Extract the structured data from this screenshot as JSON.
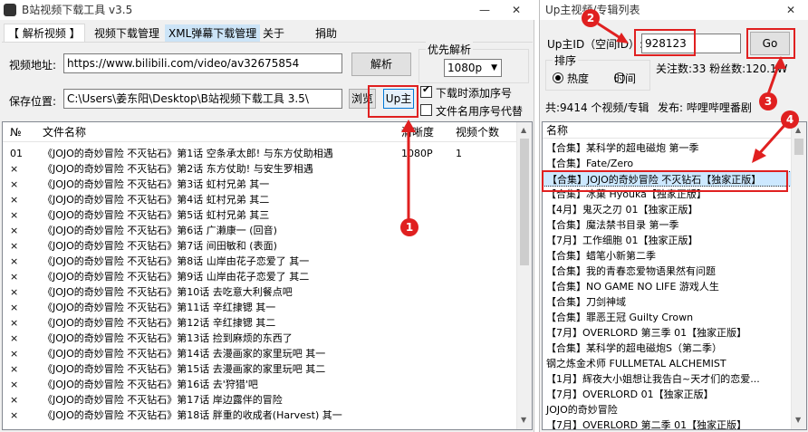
{
  "main_window": {
    "title": "B站视频下载工具 v3.5",
    "controls": {
      "minimize": "—",
      "close": "✕"
    },
    "tabs": [
      "【 解析视频 】",
      "视频下载管理",
      "XML弹幕下载管理",
      "关于",
      "捐助"
    ],
    "video_url_label": "视频地址:",
    "video_url_value": "https://www.bilibili.com/video/av32675854",
    "parse_button": "解析",
    "priority_label": "优先解析",
    "priority_value": "1080p",
    "save_label": "保存位置:",
    "save_value": "C:\\Users\\姜东阳\\Desktop\\B站视频下载工具 3.5\\",
    "browse_button": "浏览",
    "up_button": "Up主",
    "add_seq_label": "下载时添加序号",
    "filename_seq_label": "文件名用序号代替",
    "columns": [
      "№",
      "文件名称",
      "清晰度",
      "视频个数"
    ],
    "rows": [
      {
        "no": "01",
        "name": "《JOJO的奇妙冒险 不灭钻石》第1话 空条承太郎! 与东方仗助相遇",
        "quality": "1080P",
        "count": "1"
      },
      {
        "no": "×",
        "name": "《JOJO的奇妙冒险 不灭钻石》第2话 东方仗助! 与安生罗相遇",
        "quality": "",
        "count": ""
      },
      {
        "no": "×",
        "name": "《JOJO的奇妙冒险 不灭钻石》第3话 虹村兄弟 其一",
        "quality": "",
        "count": ""
      },
      {
        "no": "×",
        "name": "《JOJO的奇妙冒险 不灭钻石》第4话 虹村兄弟 其二",
        "quality": "",
        "count": ""
      },
      {
        "no": "×",
        "name": "《JOJO的奇妙冒险 不灭钻石》第5话 虹村兄弟 其三",
        "quality": "",
        "count": ""
      },
      {
        "no": "×",
        "name": "《JOJO的奇妙冒险 不灭钻石》第6话 广濑康一 (回音)",
        "quality": "",
        "count": ""
      },
      {
        "no": "×",
        "name": "《JOJO的奇妙冒险 不灭钻石》第7话 间田敏和 (表面)",
        "quality": "",
        "count": ""
      },
      {
        "no": "×",
        "name": "《JOJO的奇妙冒险 不灭钻石》第8话 山岸由花子恋爱了 其一",
        "quality": "",
        "count": ""
      },
      {
        "no": "×",
        "name": "《JOJO的奇妙冒险 不灭钻石》第9话 山岸由花子恋爱了 其二",
        "quality": "",
        "count": ""
      },
      {
        "no": "×",
        "name": "《JOJO的奇妙冒险 不灭钻石》第10话 去吃意大利餐点吧",
        "quality": "",
        "count": ""
      },
      {
        "no": "×",
        "name": "《JOJO的奇妙冒险 不灭钻石》第11话 辛红捸锶 其一",
        "quality": "",
        "count": ""
      },
      {
        "no": "×",
        "name": "《JOJO的奇妙冒险 不灭钻石》第12话 辛红捸锶 其二",
        "quality": "",
        "count": ""
      },
      {
        "no": "×",
        "name": "《JOJO的奇妙冒险 不灭钻石》第13话 捡到麻烦的东西了",
        "quality": "",
        "count": ""
      },
      {
        "no": "×",
        "name": "《JOJO的奇妙冒险 不灭钻石》第14话 去漫画家的家里玩吧 其一",
        "quality": "",
        "count": ""
      },
      {
        "no": "×",
        "name": "《JOJO的奇妙冒险 不灭钻石》第15话 去漫画家的家里玩吧 其二",
        "quality": "",
        "count": ""
      },
      {
        "no": "×",
        "name": "《JOJO的奇妙冒险 不灭钻石》第16话 去'狩猎'吧",
        "quality": "",
        "count": ""
      },
      {
        "no": "×",
        "name": "《JOJO的奇妙冒险 不灭钻石》第17话 岸边露伴的冒险",
        "quality": "",
        "count": ""
      },
      {
        "no": "×",
        "name": "《JOJO的奇妙冒险 不灭钻石》第18话 胖重的收成者(Harvest) 其一",
        "quality": "",
        "count": ""
      }
    ]
  },
  "up_window": {
    "title": "Up主视频/专辑列表",
    "close": "✕",
    "up_id_label": "Up主ID（空间ID）:",
    "up_id_value": "928123",
    "go_button": "Go",
    "sort_label": "排序",
    "sort_hot": "热度",
    "sort_time": "时间",
    "stats": "关注数:33 粉丝数:120.1W",
    "count_text": "共:9414 个视频/专辑",
    "publish_text": "发布: 哔哩哔哩番剧",
    "list_header": "名称",
    "items": [
      "【合集】某科学的超电磁炮 第一季",
      "【合集】Fate/Zero",
      "【合集】JOJO的奇妙冒险 不灭钻石【独家正版】",
      "【合集】冰菓 Hyouka【独家正版】",
      "【4月】鬼灭之刃 01【独家正版】",
      "【合集】魔法禁书目录 第一季",
      "【7月】工作细胞 01【独家正版】",
      "【合集】蜡笔小新第二季",
      "【合集】我的青春恋爱物语果然有问题",
      "【合集】NO GAME NO LIFE 游戏人生",
      "【合集】刀剑神域",
      "【合集】罪恶王冠 Guilty Crown",
      "【7月】OVERLORD 第三季 01【独家正版】",
      "【合集】某科学的超电磁炮S（第二季）",
      "钢之炼金术师 FULLMETAL ALCHEMIST",
      "【1月】辉夜大小姐想让我告白~天才们的恋爱...",
      "【7月】OVERLORD 01【独家正版】",
      "JOJO的奇妙冒险",
      "【7月】OVERLORD 第二季 01【独家正版】"
    ],
    "selected_index": 2
  },
  "callouts": [
    "1",
    "2",
    "3",
    "4"
  ],
  "colors": {
    "annotation_red": "#e02020",
    "selection_blue": "#cce8ff",
    "tab_active_bg": "#ffffff"
  }
}
